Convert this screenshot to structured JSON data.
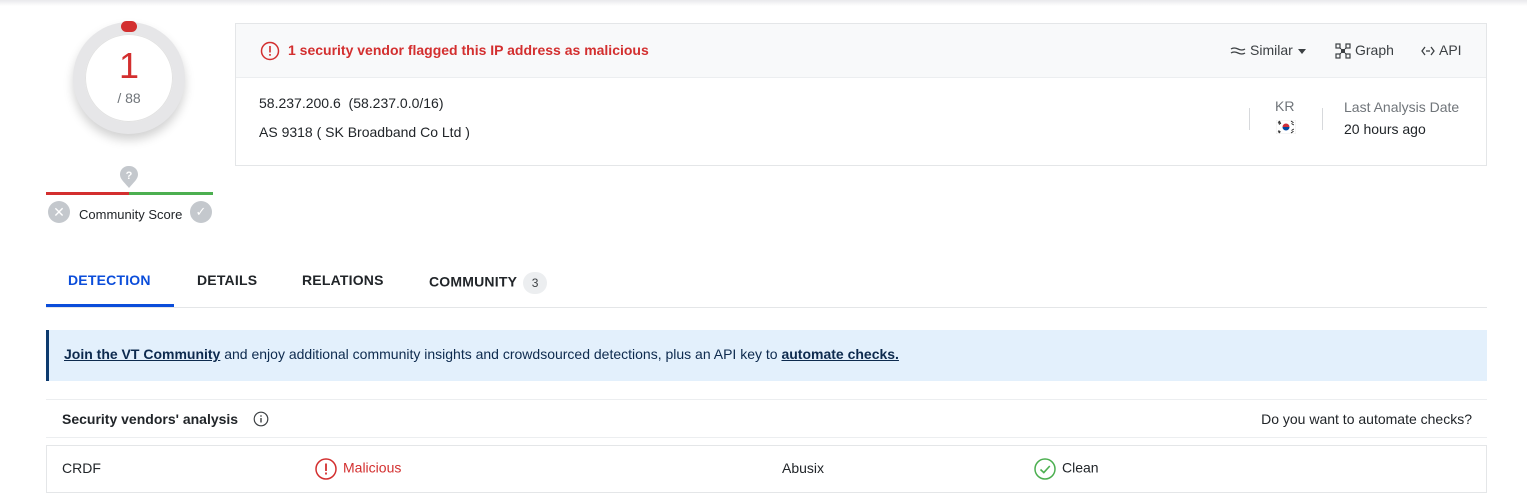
{
  "score": {
    "detections": "1",
    "total": "/ 88"
  },
  "community": {
    "label": "Community Score"
  },
  "alert": {
    "text": "1 security vendor flagged this IP address as malicious"
  },
  "actions": {
    "similar": "Similar",
    "graph": "Graph",
    "api": "API"
  },
  "ip": {
    "address": "58.237.200.6",
    "network": "(58.237.0.0/16)",
    "as_line": "AS 9318  ( SK Broadband Co Ltd )",
    "country": "KR",
    "last_analysis_label": "Last Analysis Date",
    "last_analysis_value": "20 hours ago"
  },
  "tabs": [
    {
      "label": "DETECTION"
    },
    {
      "label": "DETAILS"
    },
    {
      "label": "RELATIONS"
    },
    {
      "label": "COMMUNITY",
      "badge": "3"
    }
  ],
  "banner": {
    "link1": "Join the VT Community",
    "middle": " and enjoy additional community insights and crowdsourced detections, plus an API key to ",
    "link2": "automate checks."
  },
  "vendors": {
    "title": "Security vendors' analysis",
    "automate_question": "Do you want to automate checks?",
    "rows": [
      {
        "vendor1": "CRDF",
        "result1": "Malicious",
        "vendor2": "Abusix",
        "result2": "Clean"
      }
    ]
  },
  "colors": {
    "malicious": "#d32f2f",
    "clean": "#4caf50",
    "active_tab": "#0b4dda"
  }
}
